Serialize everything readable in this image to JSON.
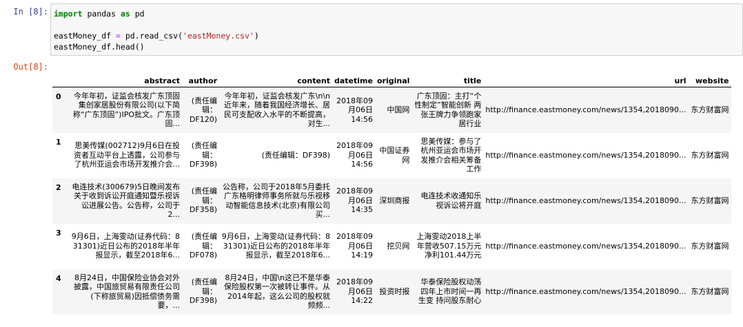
{
  "input_cell": {
    "prompt": "In [8]:",
    "code": {
      "line1": {
        "kw1": "import",
        "mod": " pandas ",
        "kw2": "as",
        "alias": " pd"
      },
      "line3": {
        "a": "eastMoney_df ",
        "eq": "=",
        "b": " pd.read_csv(",
        "s": "'eastMoney.csv'",
        "c": ")"
      },
      "line4": "eastMoney_df.head()"
    }
  },
  "output_cell": {
    "prompt": "Out[8]:",
    "columns": [
      "",
      "abstract",
      "author",
      "content",
      "datetime",
      "original",
      "title",
      "url",
      "website"
    ],
    "rows": [
      {
        "index": "0",
        "abstract": "今年年初，证监会核发广东顶固集创家居股份有限公司(以下简称“广东顶固”)IPO批文。广东顶固...",
        "author": "(责任编辑：DF120)",
        "content": "今年年初，证监会核发广东\\n\\n近年来，随着我国经济增长、居民可支配收入水平的不断提高，对生...",
        "datetime": "2018年09月06日 14:56",
        "original": "中国网",
        "title": "广东顶固：主打“个性制定”智能创新 两张王牌力争领跑家居行业",
        "url": "http://finance.eastmoney.com/news/1354,2018090...",
        "website": "东方财富网"
      },
      {
        "index": "1",
        "abstract": "思美传媒(002712)9月6日在投资者互动平台上透露，公司参与了杭州亚运会市场开发推介会...",
        "author": "(责任编辑：DF398)",
        "content": "(责任编辑：DF398)",
        "datetime": "2018年09月06日 14:56",
        "original": "中国证券网",
        "title": "思美传媒：参与了杭州亚运会市场开发推介会相关筹备工作",
        "url": "http://finance.eastmoney.com/news/1354,2018090...",
        "website": "东方财富网"
      },
      {
        "index": "2",
        "abstract": "电连技术(300679)5日晚间发布关于收到诉讼开庭通知暨乐视诉讼进展公告。公告称，公司于2...",
        "author": "(责任编辑：DF358)",
        "content": "公告称，公司于2018年5月委托广东格明律师事务所就与乐视移动智能信息技术(北京)有限公司买...",
        "datetime": "2018年09月06日 14:35",
        "original": "深圳商报",
        "title": "电连技术收通知乐视诉讼将开庭",
        "url": "http://finance.eastmoney.com/news/1354,2018090...",
        "website": "东方财富网"
      },
      {
        "index": "3",
        "abstract": "9月6日，上海雯动(证券代码：831301)近日公布的2018年半年报显示，截至2018年6...",
        "author": "(责任编辑：DF078)",
        "content": "9月6日，上海雯动(证券代码：831301)近日公布的2018年半年报显示，截至2018年6...",
        "datetime": "2018年09月06日 14:19",
        "original": "挖贝网",
        "title": "上海雯动2018上半年营收507.15万元 净利101.44万元",
        "url": "http://finance.eastmoney.com/news/1354,2018090...",
        "website": "东方财富网"
      },
      {
        "index": "4",
        "abstract": "8月24日，中国保险业协会对外披露，中国旅贸易有限责任公司(下称旅贸易)因抵偿债务需要，...",
        "author": "(责任编辑：DF398)",
        "content": "8月24日，中国\\n这已不是华泰保险股权第一次被转让事件。从2014年起，这么公司的股权就频频...",
        "datetime": "2018年09月06日 14:22",
        "original": "投资时报",
        "title": "华泰保险股权动荡 四年上市时间一再生变 持问股东耐心",
        "url": "http://finance.eastmoney.com/news/1354,2018090...",
        "website": "东方财富网"
      }
    ]
  }
}
